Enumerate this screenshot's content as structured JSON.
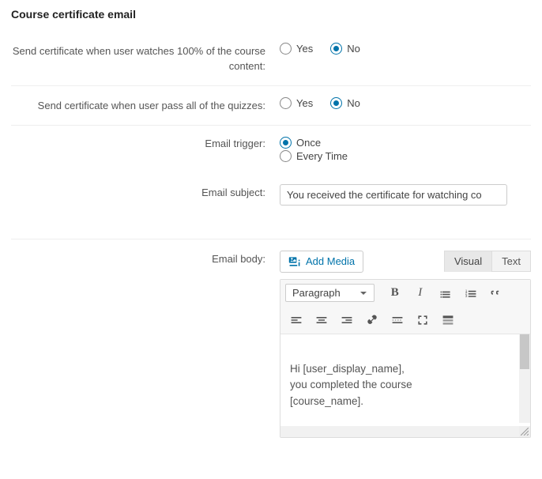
{
  "section_title": "Course certificate email",
  "fields": {
    "watch100": {
      "label": "Send certificate when user watches 100% of the course content:",
      "yes": "Yes",
      "no": "No",
      "value": "no"
    },
    "pass_quizzes": {
      "label": "Send certificate when user pass all of the quizzes:",
      "yes": "Yes",
      "no": "No",
      "value": "no"
    },
    "trigger": {
      "label": "Email trigger:",
      "once": "Once",
      "every": "Every Time",
      "value": "once"
    },
    "subject": {
      "label": "Email subject:",
      "value": "You received the certificate for watching co"
    },
    "body_label": "Email body:"
  },
  "editor": {
    "add_media": "Add Media",
    "tab_visual": "Visual",
    "tab_text": "Text",
    "format_selected": "Paragraph",
    "body_line1": "Hi [user_display_name],",
    "body_line2": "you completed the course",
    "body_line3": "[course_name]."
  }
}
